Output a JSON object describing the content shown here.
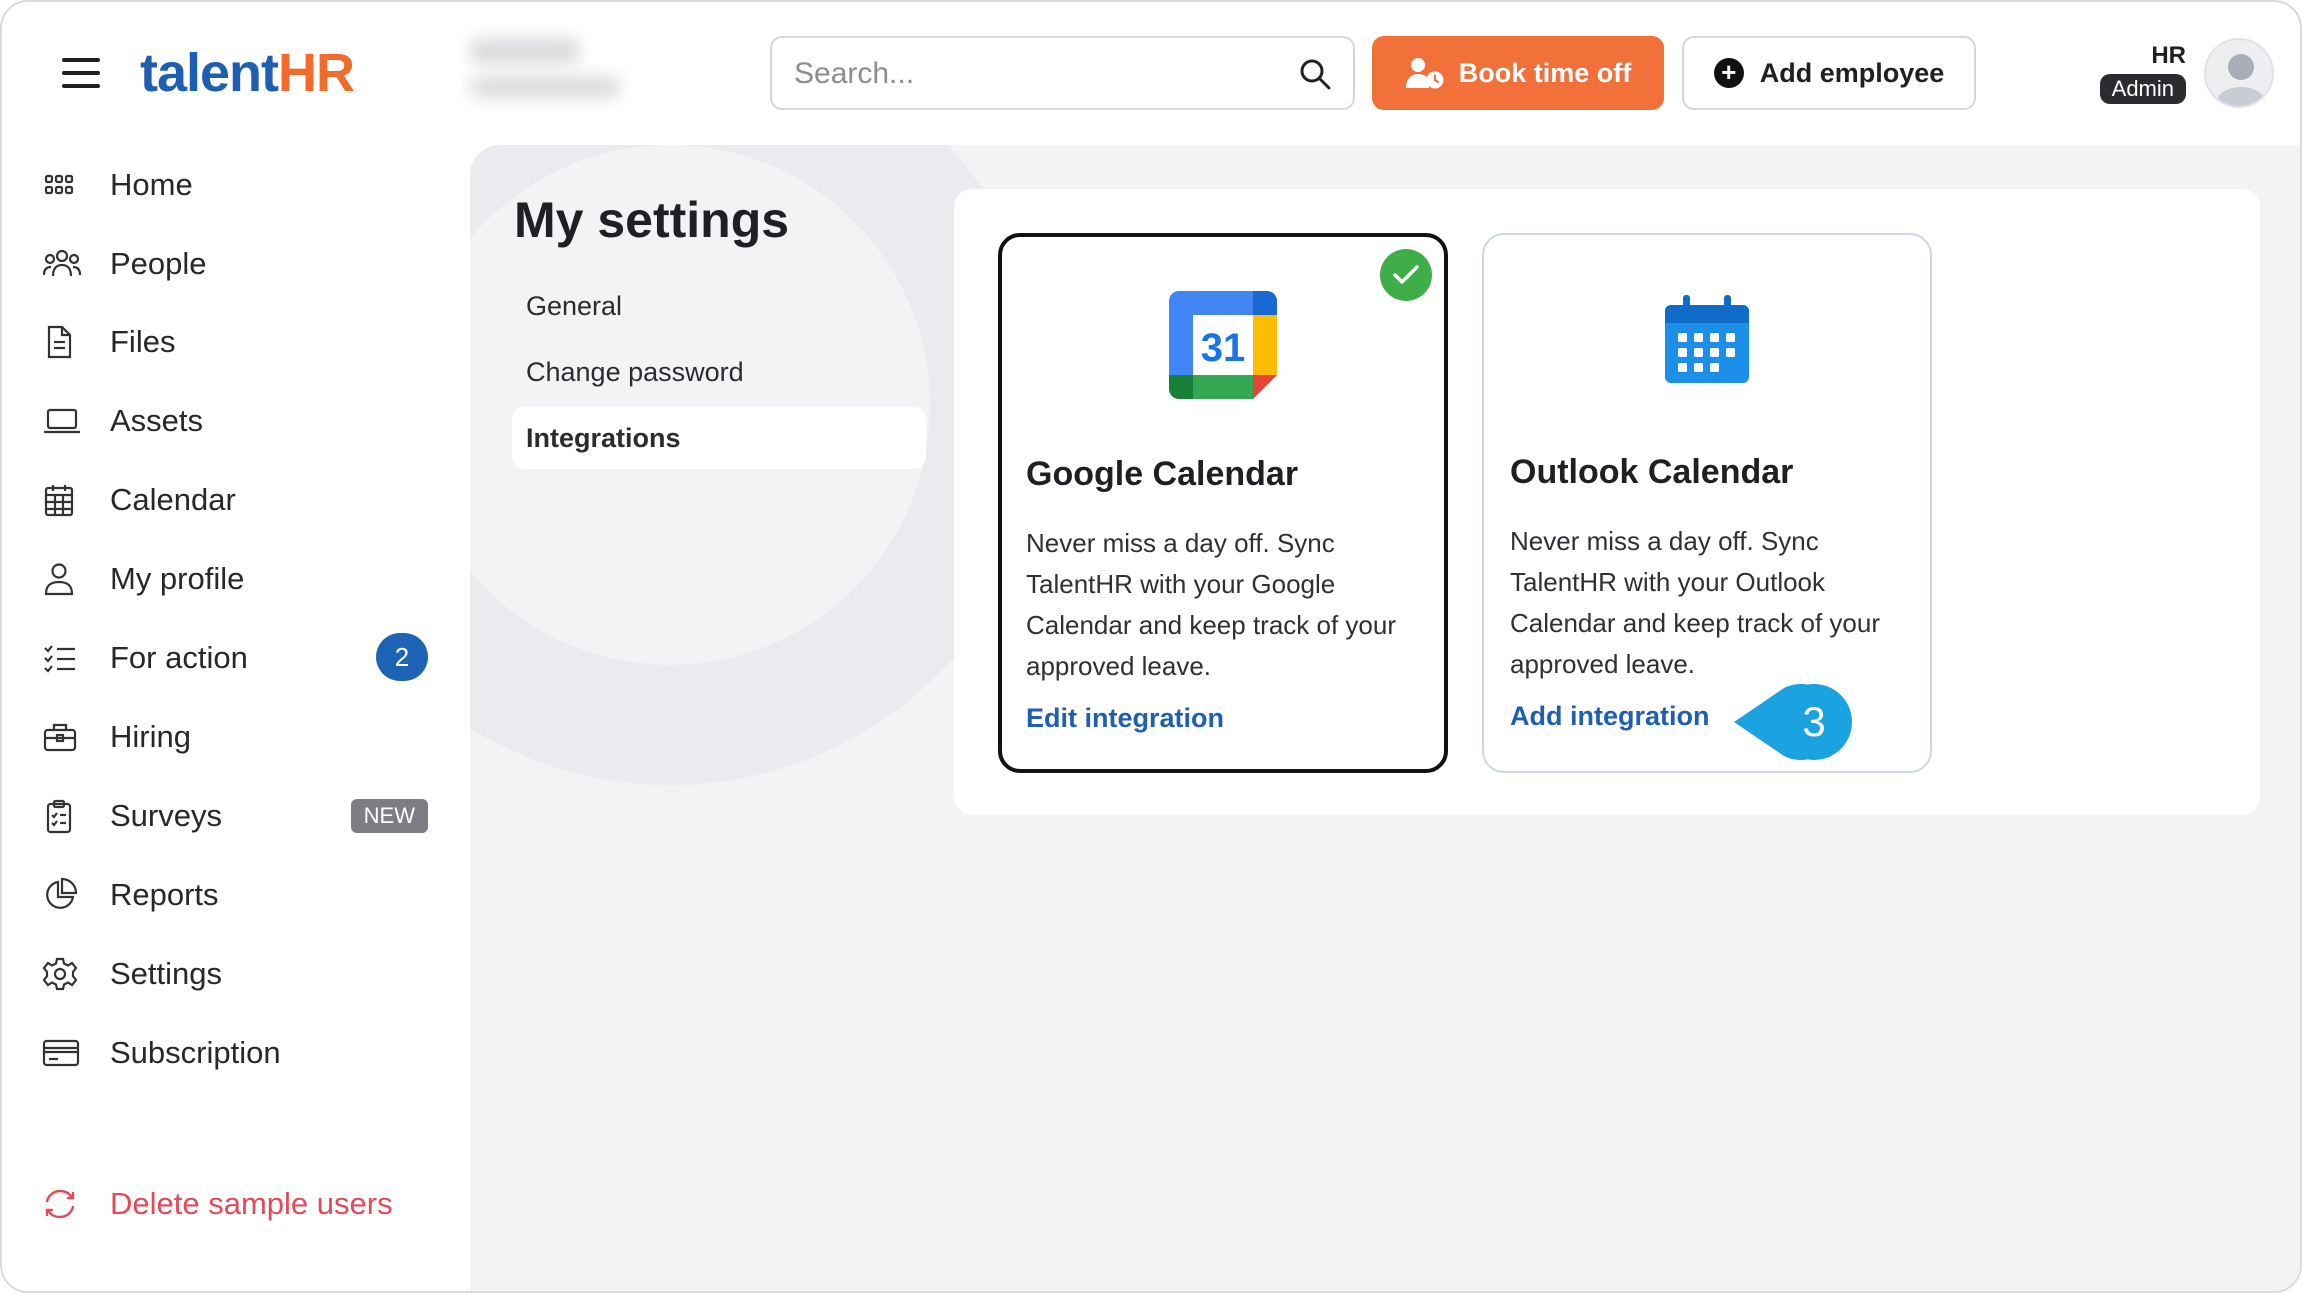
{
  "app": {
    "logo": {
      "part1": "talent",
      "part2": "HR"
    },
    "accent_color": "#f2703a",
    "brand_color": "#1f5fb2"
  },
  "header": {
    "search": {
      "placeholder": "Search...",
      "value": ""
    },
    "book_time_off_label": "Book time off",
    "add_employee_label": "Add employee",
    "user": {
      "name": "HR",
      "role": "Admin"
    }
  },
  "sidebar": {
    "items": [
      {
        "label": "Home",
        "icon": "grid-icon"
      },
      {
        "label": "People",
        "icon": "people-icon"
      },
      {
        "label": "Files",
        "icon": "file-icon"
      },
      {
        "label": "Assets",
        "icon": "laptop-icon"
      },
      {
        "label": "Calendar",
        "icon": "calendar-icon"
      },
      {
        "label": "My profile",
        "icon": "user-icon"
      },
      {
        "label": "For action",
        "icon": "checklist-icon",
        "badge": "2"
      },
      {
        "label": "Hiring",
        "icon": "briefcase-icon"
      },
      {
        "label": "Surveys",
        "icon": "clipboard-icon",
        "tag": "NEW"
      },
      {
        "label": "Reports",
        "icon": "pie-chart-icon"
      },
      {
        "label": "Settings",
        "icon": "gear-icon"
      },
      {
        "label": "Subscription",
        "icon": "credit-card-icon"
      }
    ],
    "footer_action": {
      "label": "Delete sample users",
      "icon": "refresh-icon",
      "color": "#e24a5a"
    }
  },
  "settings": {
    "title": "My settings",
    "tabs": [
      {
        "label": "General",
        "active": false
      },
      {
        "label": "Change password",
        "active": false
      },
      {
        "label": "Integrations",
        "active": true
      }
    ]
  },
  "integrations": [
    {
      "name": "Google Calendar",
      "description": "Never miss a day off. Sync TalentHR with your Google Calendar and keep track of your approved leave.",
      "action": "Edit integration",
      "connected": true,
      "logo_text": "31"
    },
    {
      "name": "Outlook Calendar",
      "description": "Never miss a day off. Sync TalentHR with your Outlook Calendar and keep track of your approved leave.",
      "action": "Add integration",
      "connected": false
    }
  ],
  "callout": {
    "step": "3",
    "color": "#1aa3e0"
  }
}
